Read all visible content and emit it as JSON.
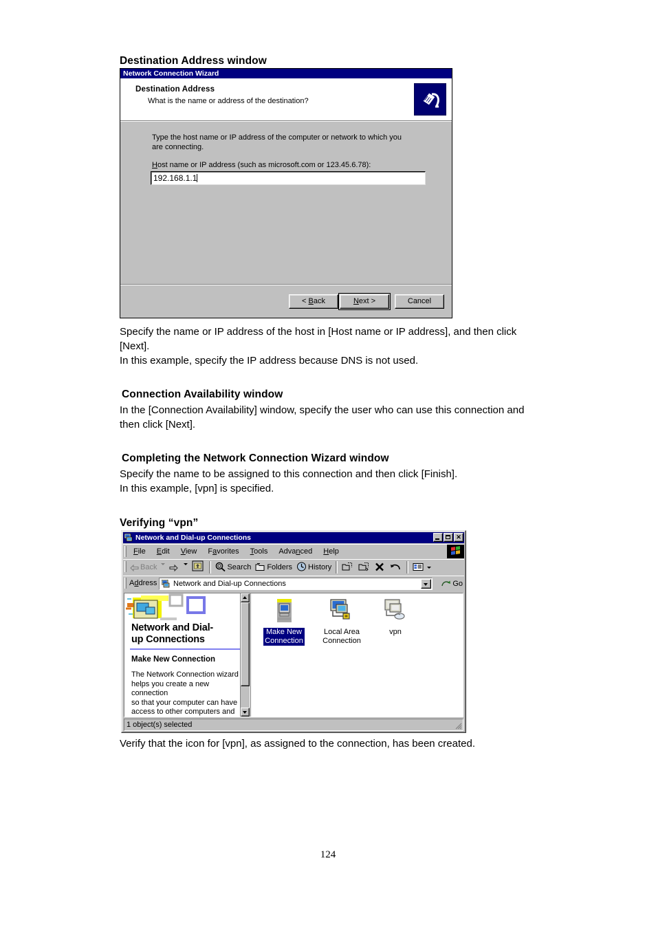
{
  "document": {
    "page_number": "124",
    "sections": [
      {
        "heading": "Destination Address window",
        "body_lines": [
          "Specify the name or IP address of the host in [Host name or IP address], and then click [Next].",
          "In this example, specify the IP address because DNS is not used."
        ]
      },
      {
        "heading": "Connection Availability window",
        "body_lines": [
          "In the [Connection Availability] window, specify the user who can use this connection and then click [Next]."
        ]
      },
      {
        "heading": "Completing the Network Connection Wizard window",
        "body_lines": [
          "Specify the name to be assigned to this connection and then click [Finish].",
          "In this example, [vpn] is specified."
        ]
      },
      {
        "heading": "Verifying “vpn”",
        "body_lines": [
          "Verify that the icon for [vpn], as assigned to the connection, has been created."
        ]
      }
    ],
    "para1_line1": "Specify the name or IP address of the host in [Host name or IP address], and then click",
    "para1_line2": "[Next].",
    "para1_line3": "In this example, specify the IP address because DNS is not used.",
    "para2_line1": "In the [Connection Availability] window, specify the user who can use this connection and",
    "para2_line2": "then click [Next].",
    "para3_line1": "Specify the name to be assigned to this connection and then click [Finish].",
    "para3_line2": "In this example, [vpn] is specified.",
    "para4_line1": "Verify that the icon for [vpn], as assigned to the connection, has been created."
  },
  "wizard": {
    "title": "Network Connection Wizard",
    "header_title": "Destination Address",
    "header_subtitle": "What is the name or address of the destination?",
    "icon_name": "modem-phone-icon",
    "intro_text": "Type the host name or IP address of the computer or network to which you are connecting.",
    "field_label_prefix": "H",
    "field_label_rest": "ost name or IP address (such as microsoft.com or 123.45.6.78):",
    "field_value": "192.168.1.1",
    "buttons": {
      "back": "< Back",
      "back_mnemonic_pre": "< ",
      "back_mnemonic": "B",
      "back_mnemonic_post": "ack",
      "next_pre": "",
      "next_mnemonic": "N",
      "next_post": "ext >",
      "cancel": "Cancel"
    }
  },
  "explorer": {
    "title": "Network and Dial-up Connections",
    "title_icon": "network-connections-icon",
    "window_buttons": {
      "minimize": "minimize-icon",
      "maximize": "maximize-icon",
      "close": "×"
    },
    "menu": [
      {
        "pre": "",
        "key": "F",
        "post": "ile",
        "name": "menu-file"
      },
      {
        "pre": "",
        "key": "E",
        "post": "dit",
        "name": "menu-edit"
      },
      {
        "pre": "",
        "key": "V",
        "post": "iew",
        "name": "menu-view"
      },
      {
        "pre": "F",
        "key": "a",
        "post": "vorites",
        "name": "menu-favorites"
      },
      {
        "pre": "",
        "key": "T",
        "post": "ools",
        "name": "menu-tools"
      },
      {
        "pre": "Adva",
        "key": "n",
        "post": "ced",
        "name": "menu-advanced"
      },
      {
        "pre": "",
        "key": "H",
        "post": "elp",
        "name": "menu-help"
      }
    ],
    "toolbar": {
      "back": "Back",
      "forward": "",
      "up": "",
      "search": "Search",
      "folders": "Folders",
      "history": "History",
      "copy_to": "",
      "move_to": "",
      "delete": "",
      "undo": "",
      "views": ""
    },
    "address": {
      "label_pre": "A",
      "label_key": "d",
      "label_post": "dress",
      "value": "Network and Dial-up Connections",
      "go_label": "Go"
    },
    "left_pane": {
      "title_line1": "Network and Dial-",
      "title_line2": "up Connections",
      "subtitle": "Make New Connection",
      "description_lines": [
        "The Network Connection wizard",
        "helps you create a new connection",
        "so that your computer can have",
        "access to other computers and"
      ]
    },
    "items": [
      {
        "label_line1": "Make New",
        "label_line2": "Connection",
        "selected": true,
        "icon": "make-new-connection-icon"
      },
      {
        "label_line1": "Local Area",
        "label_line2": "Connection",
        "selected": false,
        "icon": "local-area-connection-icon"
      },
      {
        "label_line1": "vpn",
        "label_line2": "",
        "selected": false,
        "icon": "vpn-connection-icon"
      }
    ],
    "status_text": "1 object(s) selected"
  },
  "colors": {
    "titlebar_blue": "#000080",
    "dialog_face": "#c0c0c0",
    "selection_blue": "#000080",
    "accent_rule": "#8080f0",
    "window_white": "#ffffff"
  }
}
